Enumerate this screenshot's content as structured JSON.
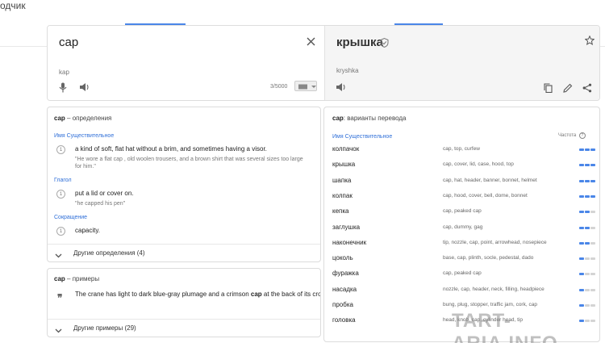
{
  "app": {
    "name": "одчик"
  },
  "source": {
    "text": "cap",
    "translit": "kap",
    "counter": "3/5000"
  },
  "target": {
    "text": "крышка",
    "translit": "kryshka"
  },
  "definitions": {
    "title_word": "cap",
    "title_rest": " – определения",
    "groups": [
      {
        "pos": "Имя Существительное",
        "entries": [
          {
            "num": "1",
            "gloss": "a kind of soft, flat hat without a brim, and sometimes having a visor.",
            "example": "\"He wore a flat cap , old woolen trousers, and a brown shirt that was several sizes too large for him.\""
          }
        ]
      },
      {
        "pos": "Глагол",
        "entries": [
          {
            "num": "1",
            "gloss": "put a lid or cover on.",
            "example": "\"he capped his pen\""
          }
        ]
      },
      {
        "pos": "Сокращение",
        "entries": [
          {
            "num": "1",
            "gloss": "capacity.",
            "example": ""
          }
        ]
      }
    ],
    "more_label": "Другие определения (4)"
  },
  "examples": {
    "title_word": "cap",
    "title_rest": " – примеры",
    "quote_icon": "quote-icon",
    "text_before": "The crane has light to dark blue-gray plumage and a crimson ",
    "text_bold": "cap",
    "text_after": " at the back of its crown.",
    "more_label": "Другие примеры (29)"
  },
  "translations": {
    "title_word": "cap",
    "title_rest": ": варианты перевода",
    "pos": "Имя Существительное",
    "freq_label": "Частота",
    "rows": [
      {
        "word": "колпачок",
        "back": "cap, top, curfew",
        "freq": 3
      },
      {
        "word": "крышка",
        "back": "cap, cover, lid, case, hood, top",
        "freq": 3
      },
      {
        "word": "шапка",
        "back": "cap, hat, header, banner, bonnet, helmet",
        "freq": 3
      },
      {
        "word": "колпак",
        "back": "cap, hood, cover, bell, dome, bonnet",
        "freq": 3
      },
      {
        "word": "кепка",
        "back": "cap, peaked cap",
        "freq": 2
      },
      {
        "word": "заглушка",
        "back": "cap, dummy, gag",
        "freq": 2
      },
      {
        "word": "наконечник",
        "back": "tip, nozzle, cap, point, arrowhead, nosepiece",
        "freq": 2
      },
      {
        "word": "цоколь",
        "back": "base, cap, plinth, socle, pedestal, dado",
        "freq": 1
      },
      {
        "word": "фуражка",
        "back": "cap, peaked cap",
        "freq": 1
      },
      {
        "word": "насадка",
        "back": "nozzle, cap, header, neck, filling, headpiece",
        "freq": 1
      },
      {
        "word": "пробка",
        "back": "bung, plug, stopper, traffic jam, cork, cap",
        "freq": 1
      },
      {
        "word": "головка",
        "back": "head, knob, cap, cylinder head, tip",
        "freq": 1
      }
    ]
  },
  "watermark": "TART-ARIA.INFO"
}
